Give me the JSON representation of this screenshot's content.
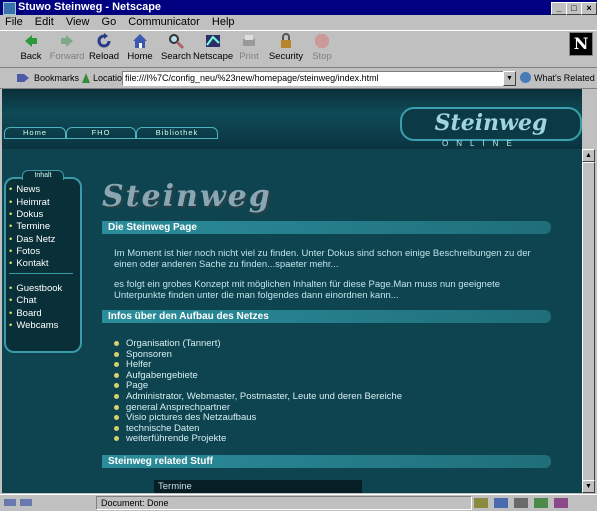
{
  "window": {
    "title": "Stuwo Steinweg - Netscape"
  },
  "menu": [
    "File",
    "Edit",
    "View",
    "Go",
    "Communicator",
    "Help"
  ],
  "toolbar": [
    {
      "label": "Back",
      "icon": "back-arrow-icon",
      "enabled": true
    },
    {
      "label": "Forward",
      "icon": "forward-arrow-icon",
      "enabled": false
    },
    {
      "label": "Reload",
      "icon": "reload-icon",
      "enabled": true
    },
    {
      "label": "Home",
      "icon": "home-icon",
      "enabled": true
    },
    {
      "label": "Search",
      "icon": "search-icon",
      "enabled": true
    },
    {
      "label": "Netscape",
      "icon": "netscape-icon",
      "enabled": true
    },
    {
      "label": "Print",
      "icon": "print-icon",
      "enabled": false
    },
    {
      "label": "Security",
      "icon": "security-lock-icon",
      "enabled": true
    },
    {
      "label": "Stop",
      "icon": "stop-icon",
      "enabled": false
    }
  ],
  "brand_letter": "N",
  "location": {
    "bookmarks_label": "Bookmarks",
    "label": "Location:",
    "url": "file:///I%7C/config_neu/%23new/homepage/steinweg/index.html",
    "related_label": "What's Related"
  },
  "site": {
    "nav_tabs": [
      "Home",
      "FHO",
      "Bibliothek"
    ],
    "logo_text": "Steinweg",
    "online_text": "ONLINE",
    "sidebar_title": "Inhalt",
    "sidebar_links_1": [
      "News",
      "Heimrat",
      "Dokus",
      "Termine",
      "Das Netz",
      "Fotos",
      "Kontakt"
    ],
    "sidebar_links_2": [
      "Guestbook",
      "Chat",
      "Board",
      "Webcams"
    ],
    "header_logo_text": "Steinweg",
    "section1_title": "Die Steinweg Page",
    "para1": "Im Moment ist hier noch nicht viel zu finden. Unter Dokus sind schon einige Beschreibungen zu der einen oder anderen Sache zu finden...spaeter mehr...",
    "para2": "es folgt ein grobes Konzept mit möglichen Inhalten für diese Page.Man muss nun geeignete Unterpunkte finden unter die man folgendes dann einordnen kann...",
    "section2_title": "Infos über den Aufbau des Netzes",
    "list": [
      "Organisation (Tannert)",
      "Sponsoren",
      "Helfer",
      "Aufgabengebiete",
      "Page",
      "Administrator, Webmaster, Postmaster, Leute und deren Bereiche",
      "general Ansprechpartner",
      "Visio pictures des Netzaufbaus",
      "technische Daten",
      "weiterführende Projekte"
    ],
    "section3_title": "Steinweg related Stuff",
    "termine_label": "Termine"
  },
  "status": {
    "text": "Document: Done"
  }
}
